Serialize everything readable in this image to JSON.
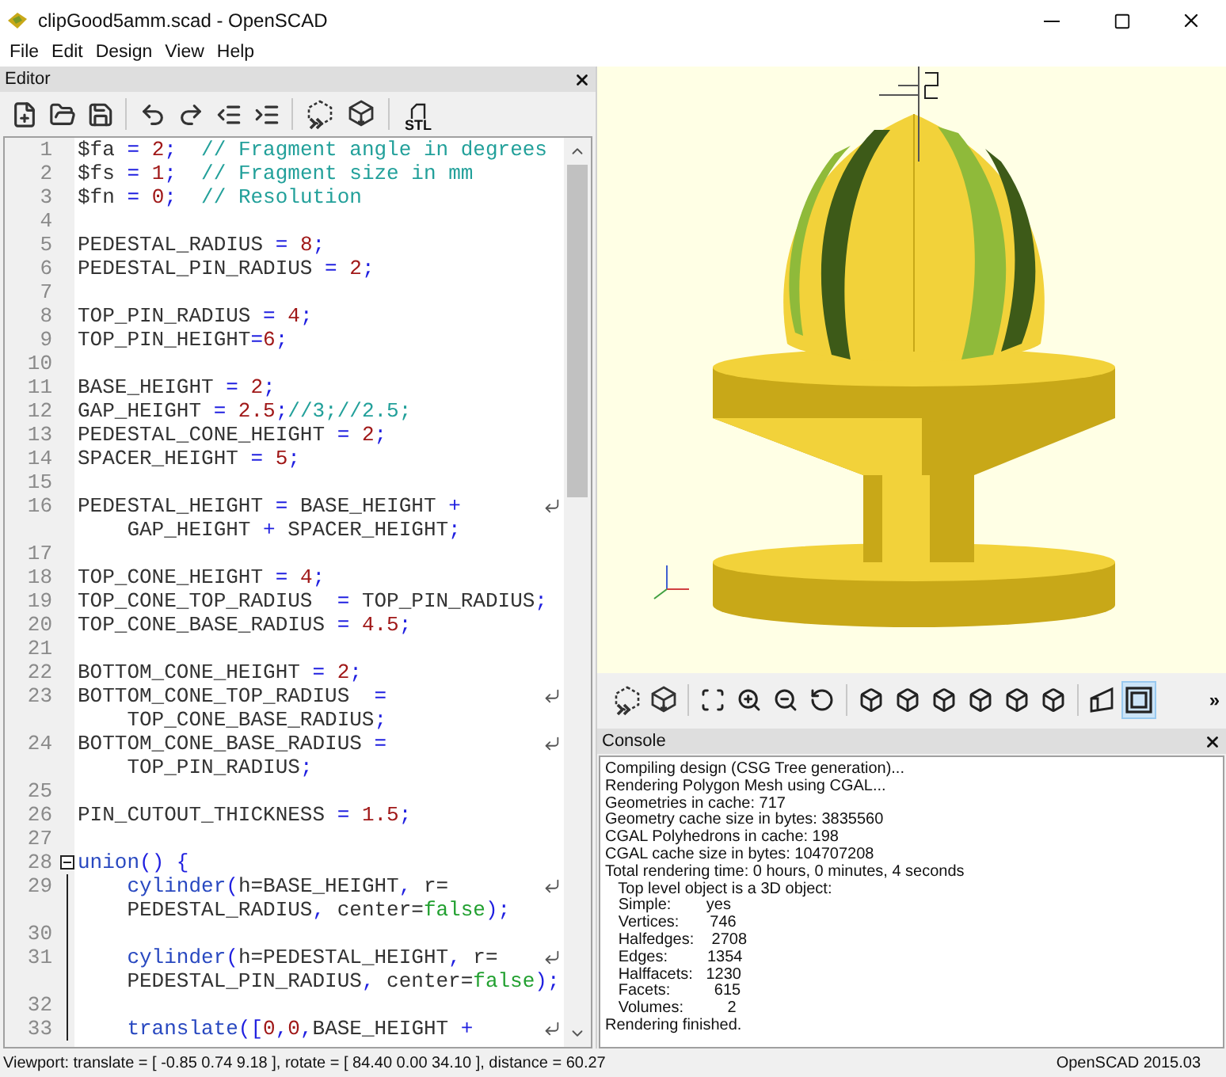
{
  "window": {
    "title": "clipGood5amm.scad - OpenSCAD"
  },
  "menu": [
    "File",
    "Edit",
    "Design",
    "View",
    "Help"
  ],
  "editor": {
    "title": "Editor",
    "toolbar": [
      {
        "kind": "new"
      },
      {
        "kind": "open"
      },
      {
        "kind": "save"
      },
      {
        "kind": "separator"
      },
      {
        "kind": "undo"
      },
      {
        "kind": "redo"
      },
      {
        "kind": "unindent"
      },
      {
        "kind": "indent"
      },
      {
        "kind": "separator"
      },
      {
        "kind": "preview"
      },
      {
        "kind": "render"
      },
      {
        "kind": "separator"
      },
      {
        "kind": "export",
        "label": "STL"
      }
    ],
    "lines": [
      {
        "number": "1",
        "rows": [
          {
            "tokens": [
              {
                "kind": "id",
                "text": "$fa"
              },
              {
                "kind": "op",
                "text": " = "
              },
              {
                "kind": "num",
                "text": "2"
              },
              {
                "kind": "op",
                "text": ";"
              },
              {
                "kind": "comment",
                "text": "  // Fragment angle in degrees"
              }
            ]
          }
        ]
      },
      {
        "number": "2",
        "rows": [
          {
            "tokens": [
              {
                "kind": "id",
                "text": "$fs"
              },
              {
                "kind": "op",
                "text": " = "
              },
              {
                "kind": "num",
                "text": "1"
              },
              {
                "kind": "op",
                "text": ";"
              },
              {
                "kind": "comment",
                "text": "  // Fragment size in mm"
              }
            ]
          }
        ]
      },
      {
        "number": "3",
        "rows": [
          {
            "tokens": [
              {
                "kind": "id",
                "text": "$fn"
              },
              {
                "kind": "op",
                "text": " = "
              },
              {
                "kind": "num",
                "text": "0"
              },
              {
                "kind": "op",
                "text": ";"
              },
              {
                "kind": "comment",
                "text": "  // Resolution"
              }
            ]
          }
        ]
      },
      {
        "number": "4",
        "rows": [
          {
            "tokens": []
          }
        ]
      },
      {
        "number": "5",
        "rows": [
          {
            "tokens": [
              {
                "kind": "id",
                "text": "PEDESTAL_RADIUS"
              },
              {
                "kind": "op",
                "text": " = "
              },
              {
                "kind": "num",
                "text": "8"
              },
              {
                "kind": "op",
                "text": ";"
              }
            ]
          }
        ]
      },
      {
        "number": "6",
        "rows": [
          {
            "tokens": [
              {
                "kind": "id",
                "text": "PEDESTAL_PIN_RADIUS"
              },
              {
                "kind": "op",
                "text": " = "
              },
              {
                "kind": "num",
                "text": "2"
              },
              {
                "kind": "op",
                "text": ";"
              }
            ]
          }
        ]
      },
      {
        "number": "7",
        "rows": [
          {
            "tokens": []
          }
        ]
      },
      {
        "number": "8",
        "rows": [
          {
            "tokens": [
              {
                "kind": "id",
                "text": "TOP_PIN_RADIUS"
              },
              {
                "kind": "op",
                "text": " = "
              },
              {
                "kind": "num",
                "text": "4"
              },
              {
                "kind": "op",
                "text": ";"
              }
            ]
          }
        ]
      },
      {
        "number": "9",
        "rows": [
          {
            "tokens": [
              {
                "kind": "id",
                "text": "TOP_PIN_HEIGHT"
              },
              {
                "kind": "op",
                "text": "="
              },
              {
                "kind": "num",
                "text": "6"
              },
              {
                "kind": "op",
                "text": ";"
              }
            ]
          }
        ]
      },
      {
        "number": "10",
        "rows": [
          {
            "tokens": []
          }
        ]
      },
      {
        "number": "11",
        "rows": [
          {
            "tokens": [
              {
                "kind": "id",
                "text": "BASE_HEIGHT"
              },
              {
                "kind": "op",
                "text": " = "
              },
              {
                "kind": "num",
                "text": "2"
              },
              {
                "kind": "op",
                "text": ";"
              }
            ]
          }
        ]
      },
      {
        "number": "12",
        "rows": [
          {
            "tokens": [
              {
                "kind": "id",
                "text": "GAP_HEIGHT"
              },
              {
                "kind": "op",
                "text": " = "
              },
              {
                "kind": "num",
                "text": "2.5"
              },
              {
                "kind": "op",
                "text": ";"
              },
              {
                "kind": "comment",
                "text": "//3;//2.5;"
              }
            ]
          }
        ]
      },
      {
        "number": "13",
        "rows": [
          {
            "tokens": [
              {
                "kind": "id",
                "text": "PEDESTAL_CONE_HEIGHT"
              },
              {
                "kind": "op",
                "text": " = "
              },
              {
                "kind": "num",
                "text": "2"
              },
              {
                "kind": "op",
                "text": ";"
              }
            ]
          }
        ]
      },
      {
        "number": "14",
        "rows": [
          {
            "tokens": [
              {
                "kind": "id",
                "text": "SPACER_HEIGHT"
              },
              {
                "kind": "op",
                "text": " = "
              },
              {
                "kind": "num",
                "text": "5"
              },
              {
                "kind": "op",
                "text": ";"
              }
            ]
          }
        ]
      },
      {
        "number": "15",
        "rows": [
          {
            "tokens": []
          }
        ]
      },
      {
        "number": "16",
        "rows": [
          {
            "wrap": true,
            "tokens": [
              {
                "kind": "id",
                "text": "PEDESTAL_HEIGHT"
              },
              {
                "kind": "op",
                "text": " = "
              },
              {
                "kind": "id",
                "text": "BASE_HEIGHT"
              },
              {
                "kind": "op",
                "text": " +"
              }
            ]
          },
          {
            "tokens": [
              {
                "kind": "id",
                "text": "    GAP_HEIGHT"
              },
              {
                "kind": "op",
                "text": " + "
              },
              {
                "kind": "id",
                "text": "SPACER_HEIGHT"
              },
              {
                "kind": "op",
                "text": ";"
              }
            ]
          }
        ]
      },
      {
        "number": "17",
        "rows": [
          {
            "tokens": []
          }
        ]
      },
      {
        "number": "18",
        "rows": [
          {
            "tokens": [
              {
                "kind": "id",
                "text": "TOP_CONE_HEIGHT"
              },
              {
                "kind": "op",
                "text": " = "
              },
              {
                "kind": "num",
                "text": "4"
              },
              {
                "kind": "op",
                "text": ";"
              }
            ]
          }
        ]
      },
      {
        "number": "19",
        "rows": [
          {
            "tokens": [
              {
                "kind": "id",
                "text": "TOP_CONE_TOP_RADIUS"
              },
              {
                "kind": "op",
                "text": "  = "
              },
              {
                "kind": "id",
                "text": "TOP_PIN_RADIUS"
              },
              {
                "kind": "op",
                "text": ";"
              }
            ]
          }
        ]
      },
      {
        "number": "20",
        "rows": [
          {
            "tokens": [
              {
                "kind": "id",
                "text": "TOP_CONE_BASE_RADIUS"
              },
              {
                "kind": "op",
                "text": " = "
              },
              {
                "kind": "num",
                "text": "4.5"
              },
              {
                "kind": "op",
                "text": ";"
              }
            ]
          }
        ]
      },
      {
        "number": "21",
        "rows": [
          {
            "tokens": []
          }
        ]
      },
      {
        "number": "22",
        "rows": [
          {
            "tokens": [
              {
                "kind": "id",
                "text": "BOTTOM_CONE_HEIGHT"
              },
              {
                "kind": "op",
                "text": " = "
              },
              {
                "kind": "num",
                "text": "2"
              },
              {
                "kind": "op",
                "text": ";"
              }
            ]
          }
        ]
      },
      {
        "number": "23",
        "rows": [
          {
            "wrap": true,
            "tokens": [
              {
                "kind": "id",
                "text": "BOTTOM_CONE_TOP_RADIUS"
              },
              {
                "kind": "op",
                "text": "  ="
              }
            ]
          },
          {
            "tokens": [
              {
                "kind": "id",
                "text": "    TOP_CONE_BASE_RADIUS"
              },
              {
                "kind": "op",
                "text": ";"
              }
            ]
          }
        ]
      },
      {
        "number": "24",
        "rows": [
          {
            "wrap": true,
            "tokens": [
              {
                "kind": "id",
                "text": "BOTTOM_CONE_BASE_RADIUS"
              },
              {
                "kind": "op",
                "text": " ="
              }
            ]
          },
          {
            "tokens": [
              {
                "kind": "id",
                "text": "    TOP_PIN_RADIUS"
              },
              {
                "kind": "op",
                "text": ";"
              }
            ]
          }
        ]
      },
      {
        "number": "25",
        "rows": [
          {
            "tokens": []
          }
        ]
      },
      {
        "number": "26",
        "rows": [
          {
            "tokens": [
              {
                "kind": "id",
                "text": "PIN_CUTOUT_THICKNESS"
              },
              {
                "kind": "op",
                "text": " = "
              },
              {
                "kind": "num",
                "text": "1.5"
              },
              {
                "kind": "op",
                "text": ";"
              }
            ]
          }
        ]
      },
      {
        "number": "27",
        "rows": [
          {
            "tokens": []
          }
        ]
      },
      {
        "number": "28",
        "fold_expanded": true,
        "rows": [
          {
            "tokens": [
              {
                "kind": "kw",
                "text": "union"
              },
              {
                "kind": "op",
                "text": "() {"
              }
            ]
          }
        ]
      },
      {
        "number": "29",
        "rows": [
          {
            "wrap": true,
            "tokens": [
              {
                "kind": "kw",
                "text": "    cylinder"
              },
              {
                "kind": "op",
                "text": "("
              },
              {
                "kind": "id",
                "text": "h=BASE_HEIGHT"
              },
              {
                "kind": "op",
                "text": ", "
              },
              {
                "kind": "id",
                "text": "r="
              }
            ]
          },
          {
            "tokens": [
              {
                "kind": "id",
                "text": "    PEDESTAL_RADIUS"
              },
              {
                "kind": "op",
                "text": ", "
              },
              {
                "kind": "id",
                "text": "center="
              },
              {
                "kind": "bool",
                "text": "false"
              },
              {
                "kind": "op",
                "text": ");"
              }
            ]
          }
        ]
      },
      {
        "number": "30",
        "rows": [
          {
            "tokens": []
          }
        ]
      },
      {
        "number": "31",
        "rows": [
          {
            "wrap": true,
            "tokens": [
              {
                "kind": "kw",
                "text": "    cylinder"
              },
              {
                "kind": "op",
                "text": "("
              },
              {
                "kind": "id",
                "text": "h=PEDESTAL_HEIGHT"
              },
              {
                "kind": "op",
                "text": ", "
              },
              {
                "kind": "id",
                "text": "r="
              }
            ]
          },
          {
            "tokens": [
              {
                "kind": "id",
                "text": "    PEDESTAL_PIN_RADIUS"
              },
              {
                "kind": "op",
                "text": ", "
              },
              {
                "kind": "id",
                "text": "center="
              },
              {
                "kind": "bool",
                "text": "false"
              },
              {
                "kind": "op",
                "text": ");"
              }
            ]
          }
        ]
      },
      {
        "number": "32",
        "rows": [
          {
            "tokens": []
          }
        ]
      },
      {
        "number": "33",
        "rows": [
          {
            "wrap": true,
            "tokens": [
              {
                "kind": "kw",
                "text": "    translate"
              },
              {
                "kind": "op",
                "text": "(["
              },
              {
                "kind": "num",
                "text": "0"
              },
              {
                "kind": "op",
                "text": ","
              },
              {
                "kind": "num",
                "text": "0"
              },
              {
                "kind": "op",
                "text": ","
              },
              {
                "kind": "id",
                "text": "BASE_HEIGHT"
              },
              {
                "kind": "op",
                "text": " +"
              }
            ]
          }
        ]
      }
    ]
  },
  "viewer_toolbar": {
    "overflow": "»",
    "buttons": [
      {
        "kind": "preview",
        "selected": false
      },
      {
        "kind": "render",
        "selected": false
      },
      {
        "kind": "separator"
      },
      {
        "kind": "zoom-all",
        "selected": false
      },
      {
        "kind": "zoom-in",
        "selected": false
      },
      {
        "kind": "zoom-out",
        "selected": false
      },
      {
        "kind": "reset",
        "selected": false
      },
      {
        "kind": "separator"
      },
      {
        "kind": "view",
        "selected": false
      },
      {
        "kind": "view",
        "selected": false
      },
      {
        "kind": "view",
        "selected": false
      },
      {
        "kind": "view",
        "selected": false
      },
      {
        "kind": "view",
        "selected": false
      },
      {
        "kind": "view",
        "selected": false
      },
      {
        "kind": "separator"
      },
      {
        "kind": "perspective",
        "selected": false
      },
      {
        "kind": "orthogonal",
        "selected": true
      }
    ]
  },
  "console": {
    "title": "Console",
    "lines": [
      "Compiling design (CSG Tree generation)...",
      "Rendering Polygon Mesh using CGAL...",
      "Geometries in cache: 717",
      "Geometry cache size in bytes: 3835560",
      "CGAL Polyhedrons in cache: 198",
      "CGAL cache size in bytes: 104707208",
      "Total rendering time: 0 hours, 0 minutes, 4 seconds",
      "   Top level object is a 3D object:",
      "   Simple:        yes",
      "   Vertices:       746",
      "   Halfedges:    2708",
      "   Edges:         1354",
      "   Halffacets:   1230",
      "   Facets:          615",
      "   Volumes:          2",
      "Rendering finished."
    ]
  },
  "status_bar": {
    "viewport": "Viewport: translate = [ -0.85 0.74 9.18 ], rotate = [ 84.40 0.00 34.10 ], distance = 60.27",
    "version": "OpenSCAD 2015.03"
  }
}
